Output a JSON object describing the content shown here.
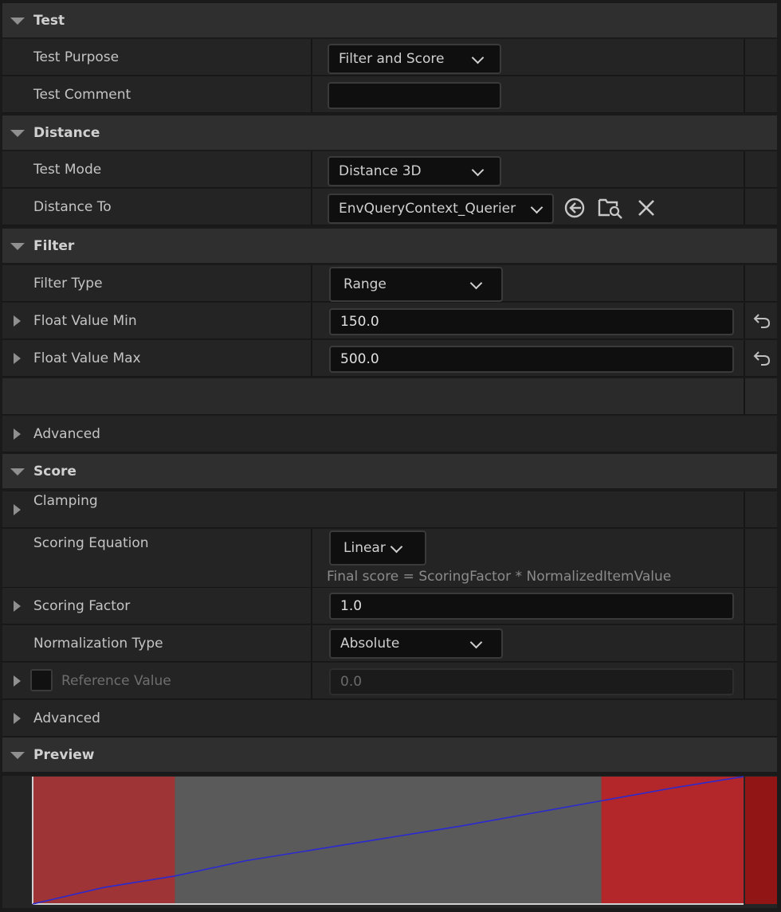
{
  "sections": {
    "test": "Test",
    "distance": "Distance",
    "filter": "Filter",
    "score": "Score",
    "preview": "Preview"
  },
  "test": {
    "purpose_label": "Test Purpose",
    "purpose_value": "Filter and Score",
    "comment_label": "Test Comment",
    "comment_value": ""
  },
  "distance": {
    "mode_label": "Test Mode",
    "mode_value": "Distance 3D",
    "to_label": "Distance To",
    "to_value": "EnvQueryContext_Querier",
    "icons": [
      "use-selected-icon",
      "browse-icon",
      "clear-icon"
    ]
  },
  "filter": {
    "type_label": "Filter Type",
    "type_value": "Range",
    "min_label": "Float Value Min",
    "min_value": "150.0",
    "max_label": "Float Value Max",
    "max_value": "500.0",
    "advanced_label": "Advanced"
  },
  "score": {
    "clamping_label": "Clamping",
    "equation_label": "Scoring Equation",
    "equation_value": "Linear",
    "equation_note": "Final score = ScoringFactor * NormalizedItemValue",
    "factor_label": "Scoring Factor",
    "factor_value": "1.0",
    "normalization_label": "Normalization Type",
    "normalization_value": "Absolute",
    "reference_label": "Reference Value",
    "reference_value": "0.0",
    "advanced_label": "Advanced"
  },
  "colors": {
    "accent_red": "#b3272b",
    "region_red": "#9e3435",
    "mid_gray": "#5a5a5a",
    "line_blue": "#2a2ad0"
  },
  "chart_data": {
    "type": "line",
    "title": "",
    "xlabel": "",
    "ylabel": "",
    "x": [
      0,
      0.1,
      0.2,
      0.3,
      0.4,
      0.5,
      0.6,
      0.7,
      0.8,
      0.9,
      1.0
    ],
    "series": [
      {
        "values": [
          0,
          0.13,
          0.22,
          0.34,
          0.43,
          0.52,
          0.61,
          0.71,
          0.81,
          0.91,
          1.0
        ]
      }
    ],
    "filtered_ranges": [
      [
        0,
        0.2
      ],
      [
        0.8,
        1.0
      ]
    ],
    "xlim": [
      0,
      1
    ],
    "ylim": [
      0,
      1
    ],
    "grid": false
  }
}
